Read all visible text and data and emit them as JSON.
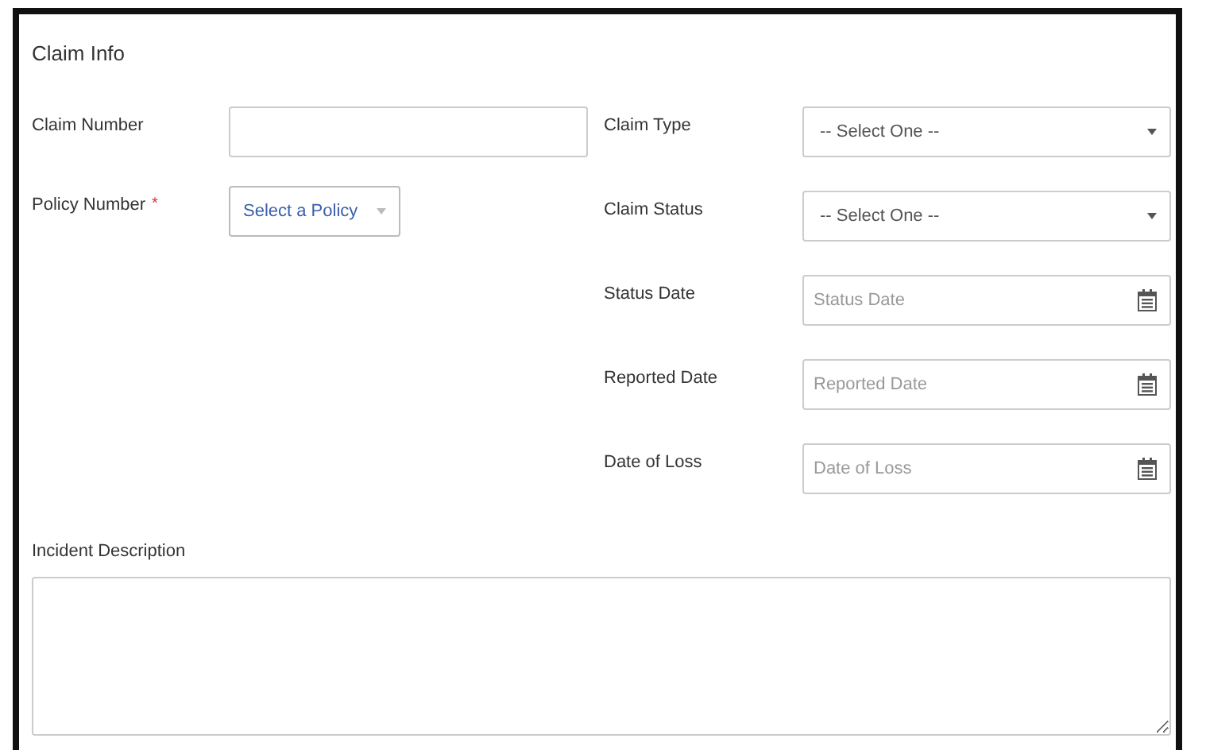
{
  "panel": {
    "title": "Claim Info"
  },
  "left_fields": [
    {
      "label": "Claim Number",
      "kind": "text"
    },
    {
      "label": "Policy Number",
      "required_mark": "*",
      "kind": "picker",
      "placeholder": "Select a Policy"
    }
  ],
  "right_fields": [
    {
      "label": "Claim Type",
      "kind": "select",
      "value": "-- Select One --"
    },
    {
      "label": "Claim Status",
      "kind": "select",
      "value": "-- Select One --"
    },
    {
      "label": "Status Date",
      "kind": "date",
      "placeholder": "Status Date"
    },
    {
      "label": "Reported Date",
      "kind": "date",
      "placeholder": "Reported Date"
    },
    {
      "label": "Date of Loss",
      "kind": "date",
      "placeholder": "Date of Loss"
    }
  ],
  "description": {
    "label": "Incident Description"
  }
}
